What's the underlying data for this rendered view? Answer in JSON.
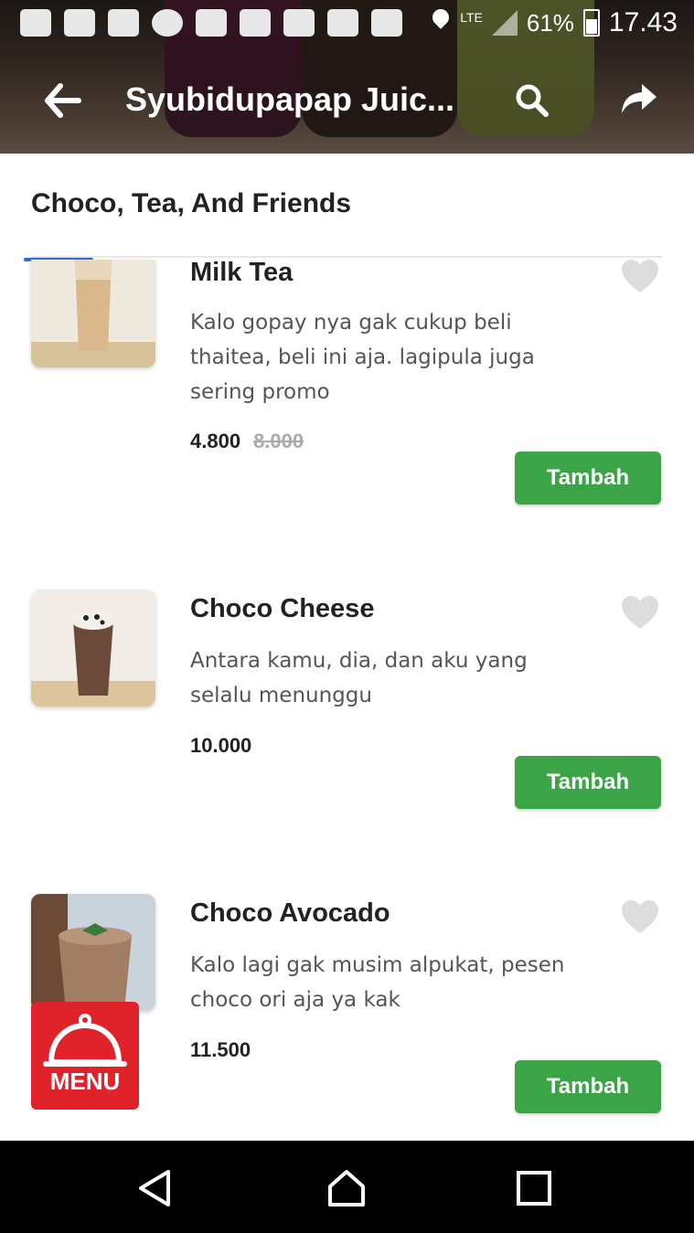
{
  "status_bar": {
    "network": "LTE",
    "battery_percent": "61%",
    "time": "17.43"
  },
  "toolbar": {
    "title": "Syubidupapap Juic...",
    "icons": [
      "back-arrow-icon",
      "search-icon",
      "share-icon"
    ]
  },
  "section": {
    "title": "Choco, Tea, And Friends"
  },
  "items": [
    {
      "name": "Milk Tea",
      "description": "Kalo gopay nya gak cukup beli thaitea, beli ini aja. lagipula juga sering promo",
      "price": "4.800",
      "old_price": "8.000",
      "add_label": "Tambah"
    },
    {
      "name": "Choco Cheese",
      "description": "Antara kamu, dia, dan aku yang selalu menunggu",
      "price": "10.000",
      "old_price": "",
      "add_label": "Tambah"
    },
    {
      "name": "Choco Avocado",
      "description": "Kalo lagi gak musim alpukat, pesen choco ori aja ya kak",
      "price": "11.500",
      "old_price": "",
      "add_label": "Tambah"
    }
  ],
  "menu_button": {
    "label": "MENU"
  },
  "colors": {
    "add_button": "#3aa447",
    "menu_button": "#e0222b",
    "heart": "#dddddd",
    "tab_indicator": "#2f6ed8"
  }
}
